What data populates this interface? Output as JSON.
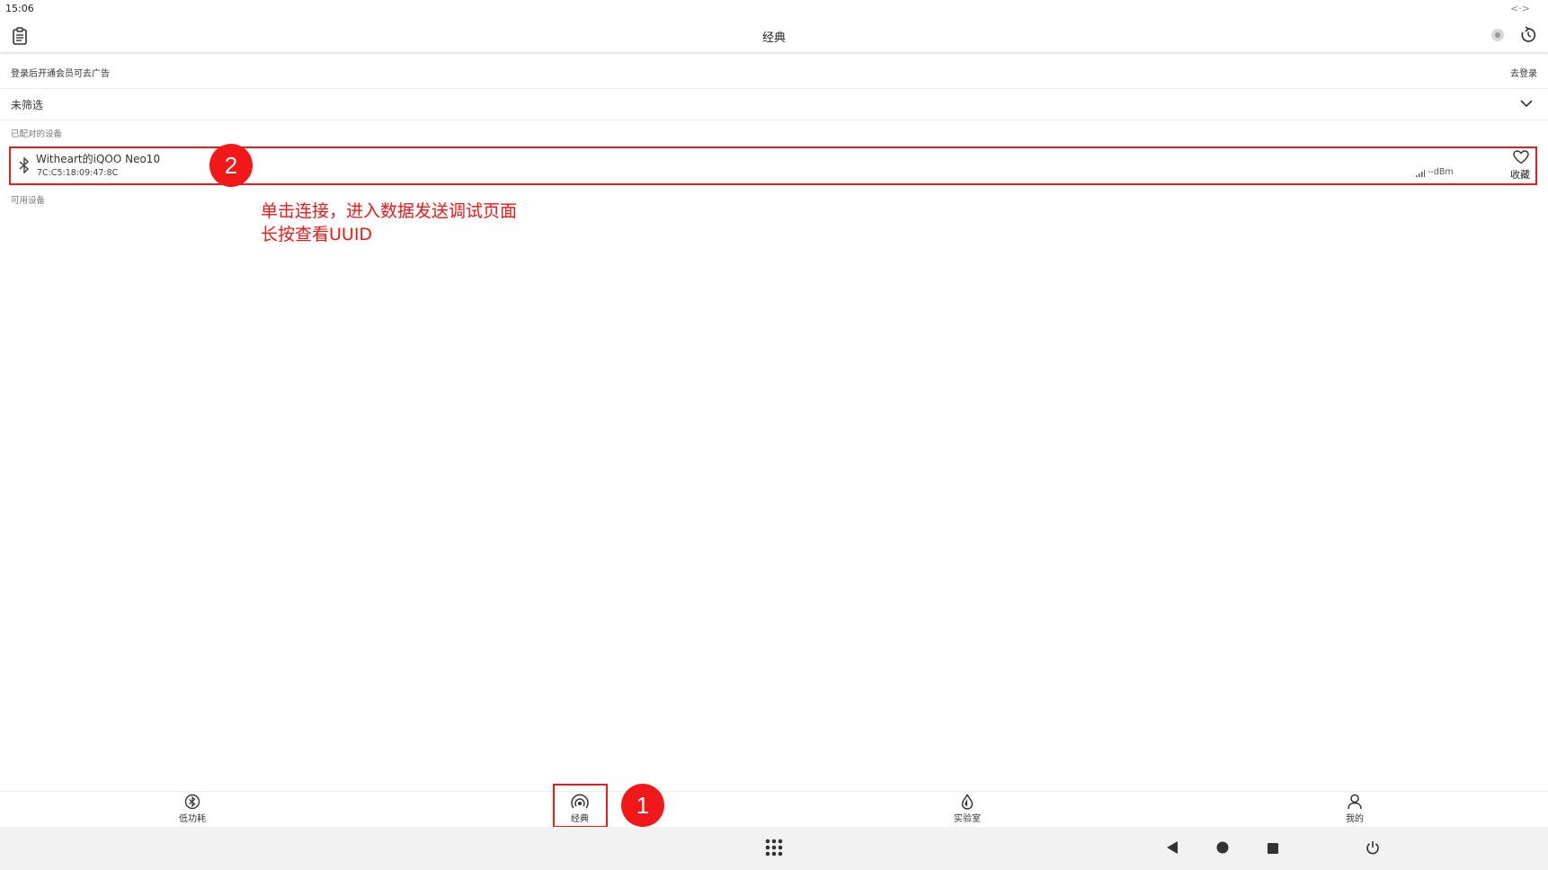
{
  "status_bar": {
    "time": "15:06",
    "right_glyph": "<·>"
  },
  "app_bar": {
    "title": "经典",
    "left_icon": "clipboard-icon",
    "right_icons": [
      "status-dot-icon",
      "refresh-timer-icon"
    ]
  },
  "ad_banner": {
    "text": "登录后开通会员可去广告",
    "action": "去登录"
  },
  "filter": {
    "label": "未筛选",
    "icon": "chevron-down-icon"
  },
  "paired_section": {
    "title": "已配对的设备",
    "devices": [
      {
        "name": "Witheart的iQOO Neo10",
        "mac": "7C:C5:18:09:47:8C",
        "rssi": "--dBm",
        "favorite_label": "收藏"
      }
    ]
  },
  "available_section": {
    "title": "可用设备"
  },
  "annotations": {
    "badge_1": "1",
    "badge_2": "2",
    "note_line1": "单击连接，进入数据发送调试页面",
    "note_line2": "长按查看UUID",
    "color": "#f01818"
  },
  "bottom_nav": {
    "items": [
      {
        "label": "低功耗",
        "icon": "bluetooth-low-energy-icon"
      },
      {
        "label": "经典",
        "icon": "signal-broadcast-icon",
        "selected": true
      },
      {
        "label": "实验室",
        "icon": "flask-drop-icon"
      },
      {
        "label": "我的",
        "icon": "person-icon"
      }
    ]
  },
  "system_nav": {
    "icons": [
      "app-grid-icon",
      "back-icon",
      "home-icon",
      "recents-icon",
      "power-icon"
    ]
  }
}
